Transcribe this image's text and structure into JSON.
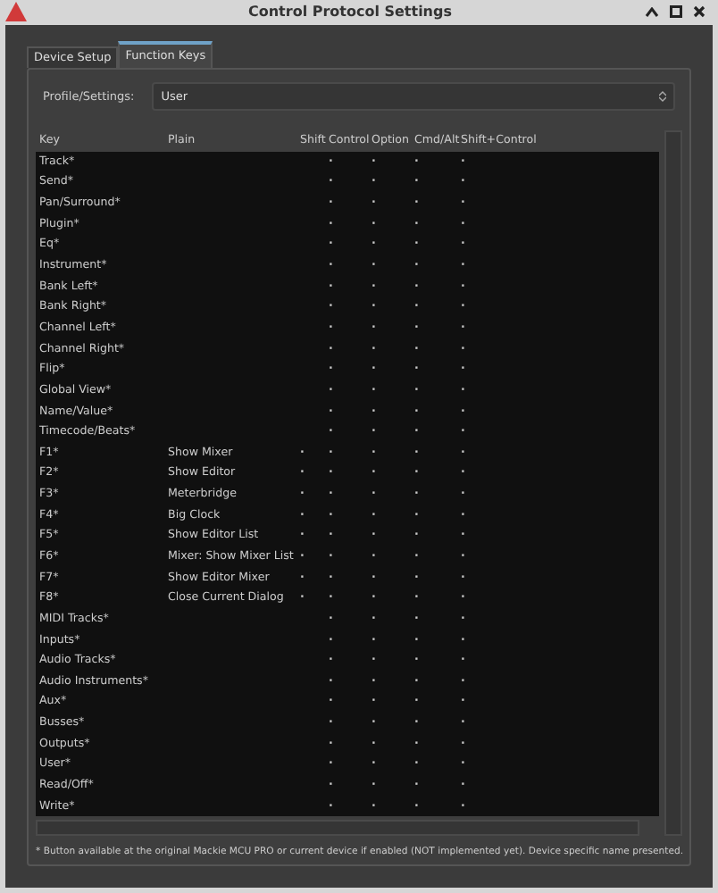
{
  "window": {
    "title": "Control Protocol Settings"
  },
  "tabs": [
    {
      "label": "Device Setup",
      "selected": false
    },
    {
      "label": "Function Keys",
      "selected": true
    }
  ],
  "profile": {
    "label": "Profile/Settings:",
    "value": "User"
  },
  "table": {
    "columns": [
      "Key",
      "Plain",
      "Shift",
      "Control",
      "Option",
      "Cmd/Alt",
      "Shift+Control"
    ],
    "rows": [
      {
        "key": "Track*",
        "control": "·",
        "option": "·",
        "cmd_alt": "·",
        "shift_control": "·"
      },
      {
        "key": "Send*",
        "control": "·",
        "option": "·",
        "cmd_alt": "·",
        "shift_control": "·"
      },
      {
        "key": "Pan/Surround*",
        "control": "·",
        "option": "·",
        "cmd_alt": "·",
        "shift_control": "·"
      },
      {
        "key": "Plugin*",
        "control": "·",
        "option": "·",
        "cmd_alt": "·",
        "shift_control": "·"
      },
      {
        "key": "Eq*",
        "control": "·",
        "option": "·",
        "cmd_alt": "·",
        "shift_control": "·"
      },
      {
        "key": "Instrument*",
        "control": "·",
        "option": "·",
        "cmd_alt": "·",
        "shift_control": "·"
      },
      {
        "key": "Bank Left*",
        "control": "·",
        "option": "·",
        "cmd_alt": "·",
        "shift_control": "·"
      },
      {
        "key": "Bank Right*",
        "control": "·",
        "option": "·",
        "cmd_alt": "·",
        "shift_control": "·"
      },
      {
        "key": "Channel Left*",
        "control": "·",
        "option": "·",
        "cmd_alt": "·",
        "shift_control": "·"
      },
      {
        "key": "Channel Right*",
        "control": "·",
        "option": "·",
        "cmd_alt": "·",
        "shift_control": "·"
      },
      {
        "key": "Flip*",
        "control": "·",
        "option": "·",
        "cmd_alt": "·",
        "shift_control": "·"
      },
      {
        "key": "Global View*",
        "control": "·",
        "option": "·",
        "cmd_alt": "·",
        "shift_control": "·"
      },
      {
        "key": "Name/Value*",
        "control": "·",
        "option": "·",
        "cmd_alt": "·",
        "shift_control": "·"
      },
      {
        "key": "Timecode/Beats*",
        "control": "·",
        "option": "·",
        "cmd_alt": "·",
        "shift_control": "·"
      },
      {
        "key": "F1*",
        "plain": "Show Mixer",
        "shift": "·",
        "control": "·",
        "option": "·",
        "cmd_alt": "·",
        "shift_control": "·"
      },
      {
        "key": "F2*",
        "plain": "Show Editor",
        "shift": "·",
        "control": "·",
        "option": "·",
        "cmd_alt": "·",
        "shift_control": "·"
      },
      {
        "key": "F3*",
        "plain": "Meterbridge",
        "shift": "·",
        "control": "·",
        "option": "·",
        "cmd_alt": "·",
        "shift_control": "·"
      },
      {
        "key": "F4*",
        "plain": "Big Clock",
        "shift": "·",
        "control": "·",
        "option": "·",
        "cmd_alt": "·",
        "shift_control": "·"
      },
      {
        "key": "F5*",
        "plain": "Show Editor List",
        "shift": "·",
        "control": "·",
        "option": "·",
        "cmd_alt": "·",
        "shift_control": "·"
      },
      {
        "key": "F6*",
        "plain": "Mixer: Show Mixer List",
        "shift": "·",
        "control": "·",
        "option": "·",
        "cmd_alt": "·",
        "shift_control": "·"
      },
      {
        "key": "F7*",
        "plain": "Show Editor Mixer",
        "shift": "·",
        "control": "·",
        "option": "·",
        "cmd_alt": "·",
        "shift_control": "·"
      },
      {
        "key": "F8*",
        "plain": "Close Current Dialog",
        "shift": "·",
        "control": "·",
        "option": "·",
        "cmd_alt": "·",
        "shift_control": "·"
      },
      {
        "key": "MIDI Tracks*",
        "control": "·",
        "option": "·",
        "cmd_alt": "·",
        "shift_control": "·"
      },
      {
        "key": "Inputs*",
        "control": "·",
        "option": "·",
        "cmd_alt": "·",
        "shift_control": "·"
      },
      {
        "key": "Audio Tracks*",
        "control": "·",
        "option": "·",
        "cmd_alt": "·",
        "shift_control": "·"
      },
      {
        "key": "Audio Instruments*",
        "control": "·",
        "option": "·",
        "cmd_alt": "·",
        "shift_control": "·"
      },
      {
        "key": "Aux*",
        "control": "·",
        "option": "·",
        "cmd_alt": "·",
        "shift_control": "·"
      },
      {
        "key": "Busses*",
        "control": "·",
        "option": "·",
        "cmd_alt": "·",
        "shift_control": "·"
      },
      {
        "key": "Outputs*",
        "control": "·",
        "option": "·",
        "cmd_alt": "·",
        "shift_control": "·"
      },
      {
        "key": "User*",
        "control": "·",
        "option": "·",
        "cmd_alt": "·",
        "shift_control": "·"
      },
      {
        "key": "Read/Off*",
        "control": "·",
        "option": "·",
        "cmd_alt": "·",
        "shift_control": "·"
      },
      {
        "key": "Write*",
        "control": "·",
        "option": "·",
        "cmd_alt": "·",
        "shift_control": "·"
      }
    ]
  },
  "footnote": "* Button available at the original Mackie MCU PRO or current device if enabled (NOT implemented yet). Device specific name presented."
}
